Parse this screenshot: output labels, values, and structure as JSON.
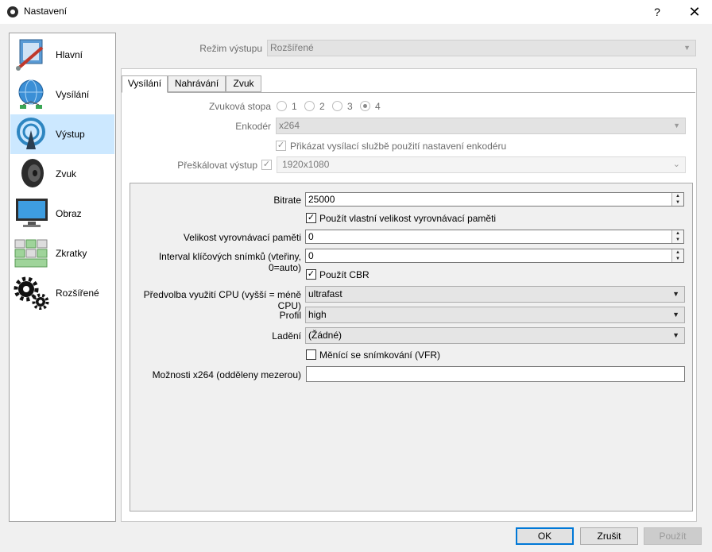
{
  "window": {
    "title": "Nastavení",
    "help": "?",
    "close": "✕"
  },
  "sidebar": {
    "items": [
      {
        "label": "Hlavní",
        "icon": "general-icon"
      },
      {
        "label": "Vysílání",
        "icon": "stream-globe-icon"
      },
      {
        "label": "Výstup",
        "icon": "output-broadcast-icon",
        "selected": true
      },
      {
        "label": "Zvuk",
        "icon": "speaker-icon"
      },
      {
        "label": "Obraz",
        "icon": "monitor-icon"
      },
      {
        "label": "Zkratky",
        "icon": "keyboard-icon"
      },
      {
        "label": "Rozšířené",
        "icon": "gears-icon"
      }
    ]
  },
  "output_mode": {
    "label": "Režim výstupu",
    "value": "Rozšířené"
  },
  "tabs": [
    "Vysílání",
    "Nahrávání",
    "Zvuk"
  ],
  "streaming": {
    "audio_track_label": "Zvuková stopa",
    "audio_tracks": [
      "1",
      "2",
      "3",
      "4"
    ],
    "audio_track_selected": "4",
    "encoder_label": "Enkodér",
    "encoder_value": "x264",
    "enforce_label": "Přikázat vysílací službě použití nastavení enkodéru",
    "rescale_label": "Přeškálovat výstup",
    "rescale_value": "1920x1080"
  },
  "encoder_settings": {
    "bitrate_label": "Bitrate",
    "bitrate_value": "25000",
    "custom_buffer_label": "Použít vlastní velikost vyrovnávací paměti",
    "buffer_size_label": "Velikost vyrovnávací paměti",
    "buffer_size_value": "0",
    "keyframe_label": "Interval klíčových snímků (vteřiny, 0=auto)",
    "keyframe_value": "0",
    "cbr_label": "Použít CBR",
    "cpu_preset_label": "Předvolba využití CPU (vyšší = méně CPU)",
    "cpu_preset_value": "ultrafast",
    "profile_label": "Profil",
    "profile_value": "high",
    "tune_label": "Ladění",
    "tune_value": "(Žádné)",
    "vfr_label": "Měnící se snímkování (VFR)",
    "x264_opts_label": "Možnosti x264 (odděleny mezerou)",
    "x264_opts_value": ""
  },
  "buttons": {
    "ok": "OK",
    "cancel": "Zrušit",
    "apply": "Použít"
  },
  "colors": {
    "selected_bg": "#cce8ff",
    "accent": "#0078d7"
  }
}
